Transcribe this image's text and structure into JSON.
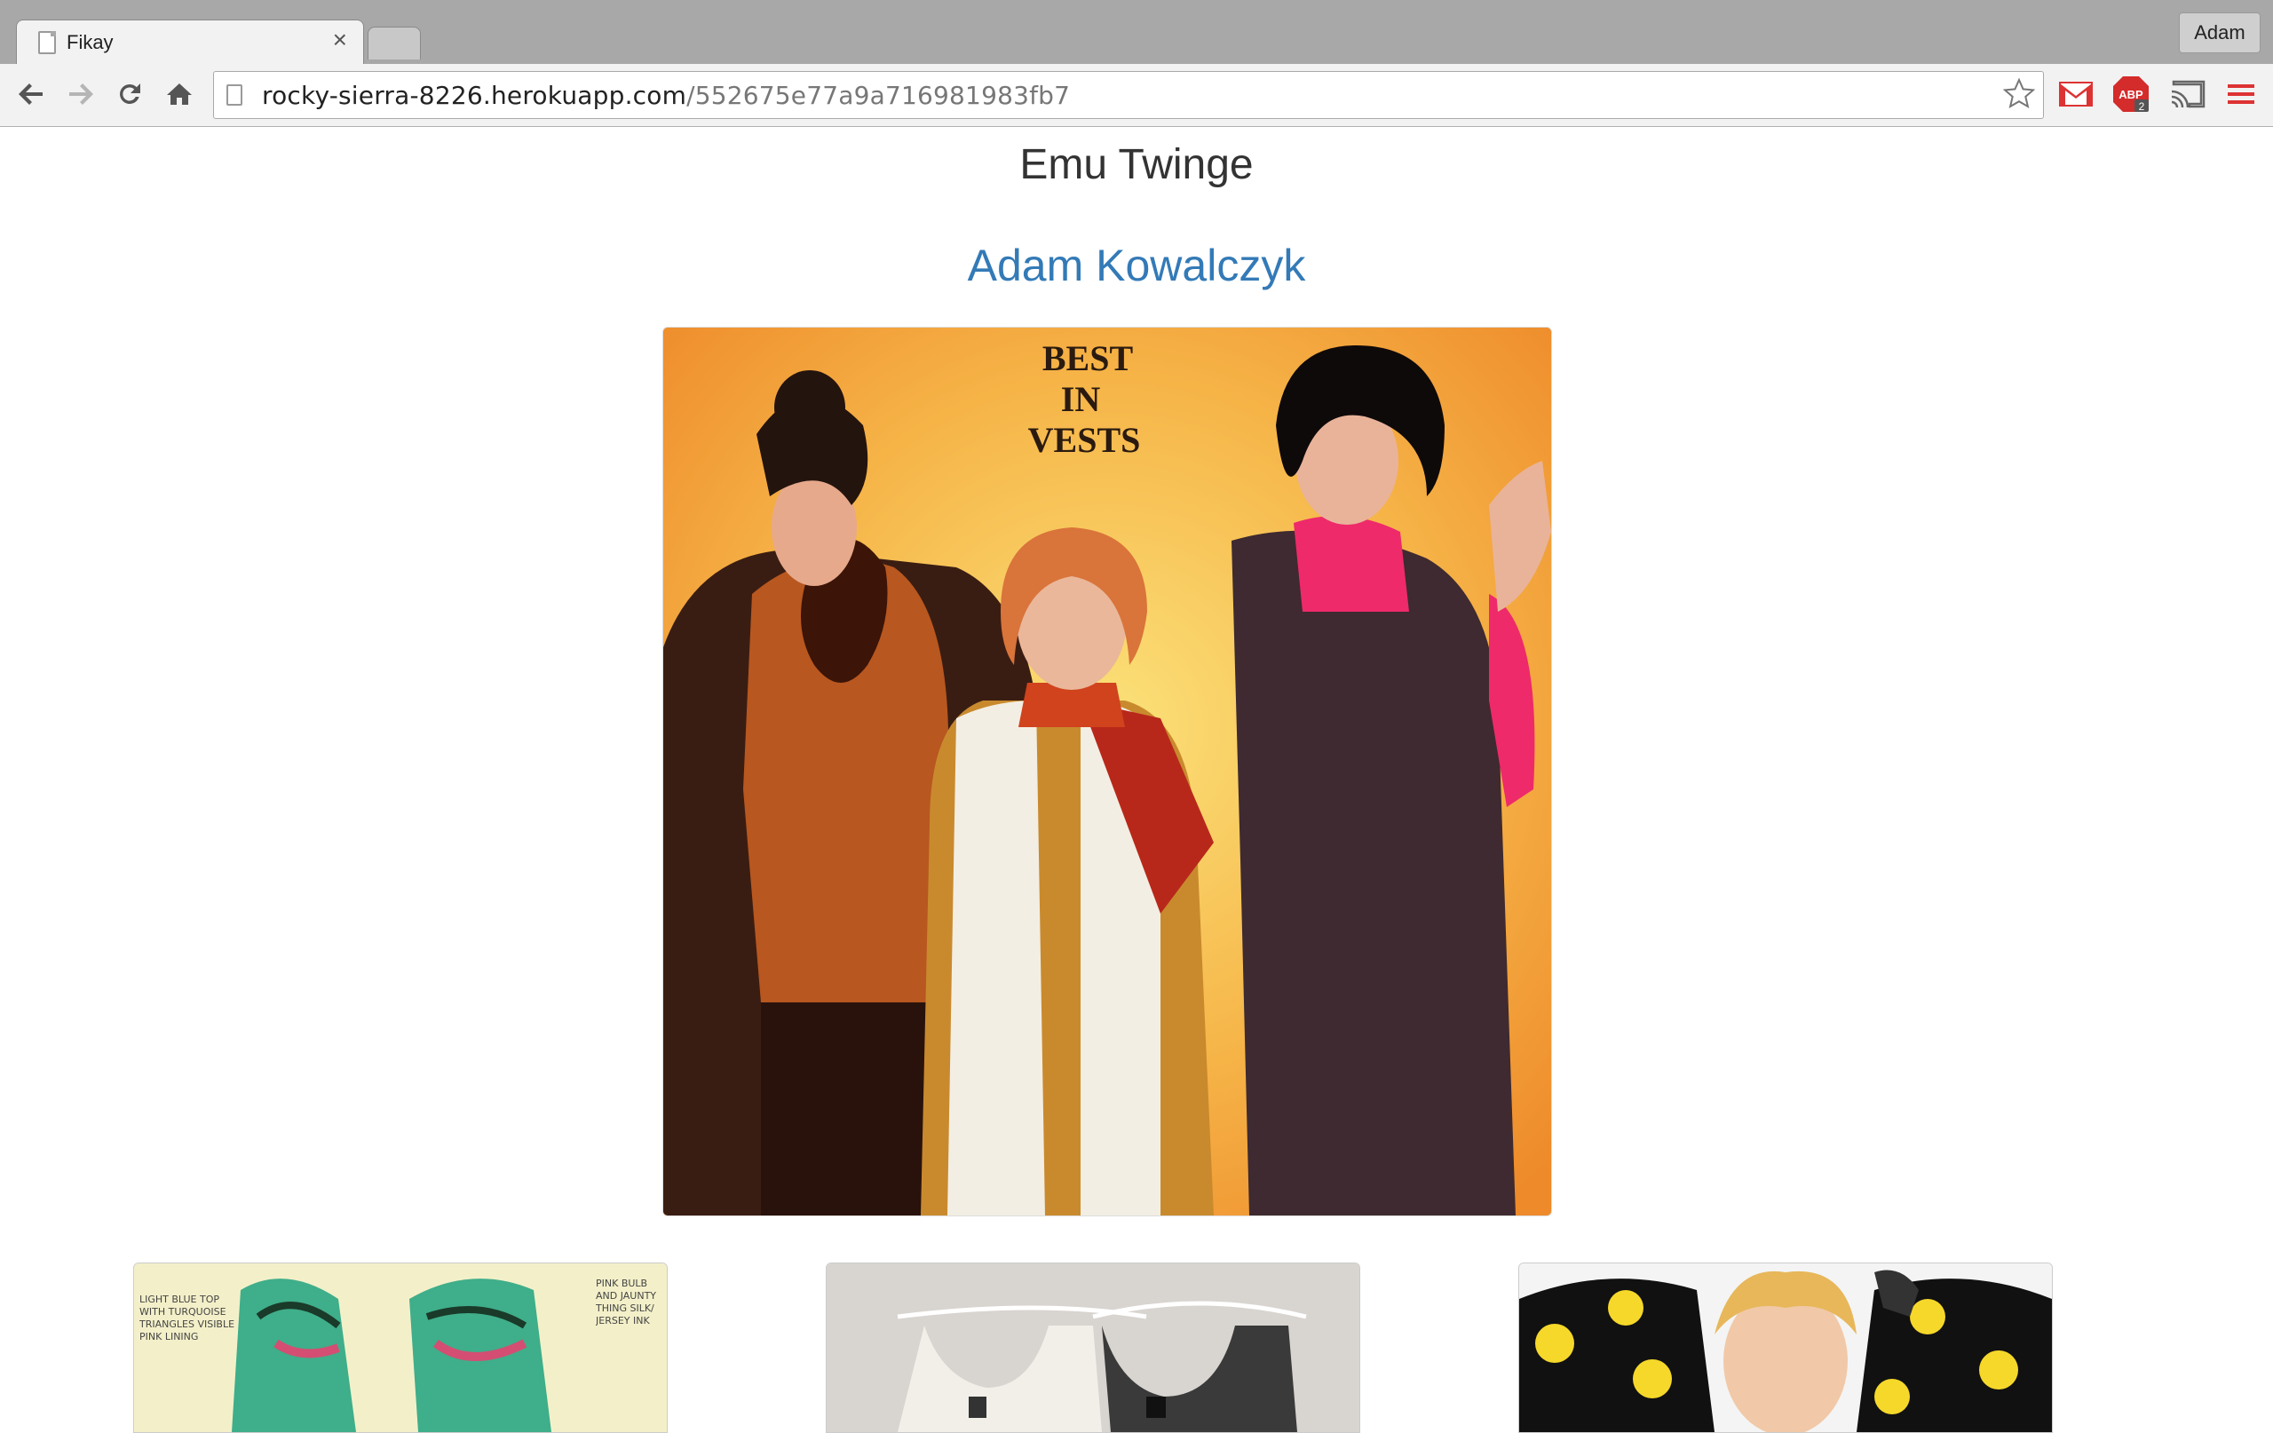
{
  "browser": {
    "tab_title": "Fikay",
    "tab_close": "×",
    "profile_name": "Adam",
    "url_host": "rocky-sierra-8226.herokuapp.com",
    "url_path": "/552675e77a9a716981983fb7",
    "adblock_label": "ABP",
    "adblock_count": "2"
  },
  "page": {
    "title": "Emu Twinge",
    "author": "Adam Kowalczyk"
  },
  "main_image": {
    "caption_line1": "BEST",
    "caption_line2": "IN",
    "caption_line3": "VESTS"
  },
  "thumbnails": [
    {
      "notes_left": "LIGHT BLUE TOP WITH TURQUOISE TRIANGLES VISIBLE PINK LINING",
      "notes_right": "PINK BULB AND JAUNTY THING SILK/ JERSEY INK"
    },
    {},
    {}
  ],
  "colors": {
    "link": "#337ab7",
    "chrome_bg": "#a8a8a8",
    "toolbar_bg": "#f2f2f2"
  }
}
